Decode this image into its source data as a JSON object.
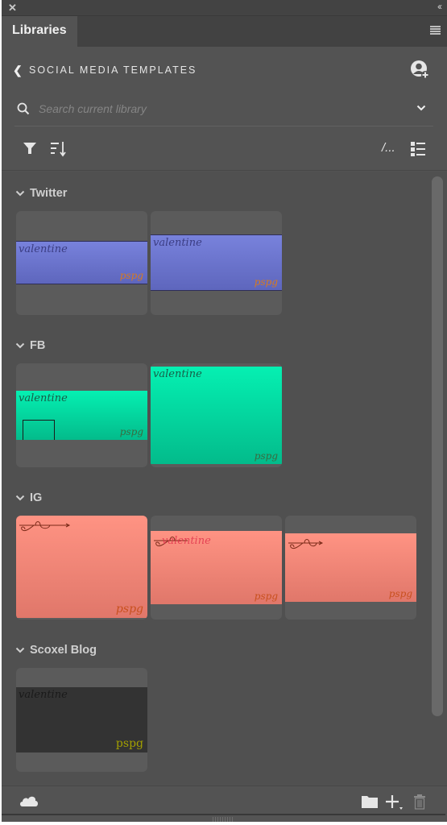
{
  "window": {
    "close_icon": "close-icon",
    "collapse_icon": "double-chevron-left-icon",
    "tab_label": "Libraries",
    "panel_menu_icon": "hamburger-menu-icon"
  },
  "library": {
    "back_icon": "chevron-left-icon",
    "title": "SOCIAL MEDIA TEMPLATES",
    "invite_icon": "user-add-icon"
  },
  "search": {
    "placeholder": "Search current library",
    "value": "",
    "search_icon": "search-icon",
    "dropdown_icon": "chevron-down-icon"
  },
  "toolbar": {
    "filter_icon": "filter-icon",
    "sort_icon": "sort-icon",
    "path_label": "/...",
    "view_icon": "list-view-icon"
  },
  "groups": [
    {
      "name": "Twitter",
      "color": "#6e78d2",
      "items": [
        {
          "script": "valentine",
          "mark": "pspg"
        },
        {
          "script": "valentine",
          "mark": "pspg"
        }
      ]
    },
    {
      "name": "FB",
      "color": "#04dca0",
      "items": [
        {
          "script": "valentine",
          "mark": "pspg"
        },
        {
          "script": "valentine",
          "mark": "pspg"
        }
      ]
    },
    {
      "name": "IG",
      "color": "#ff8878",
      "items": [
        {
          "script": "",
          "mark": "pspg"
        },
        {
          "script": "valentine",
          "mark": "pspg"
        },
        {
          "script": "",
          "mark": "pspg"
        }
      ]
    },
    {
      "name": "Scoxel Blog",
      "color": "#333333",
      "items": [
        {
          "script": "valentine",
          "mark": "pspg"
        }
      ]
    }
  ],
  "footer": {
    "cloud_icon": "cloud-icon",
    "new_group_icon": "folder-icon",
    "add_icon": "plus-icon",
    "delete_icon": "trash-icon"
  }
}
